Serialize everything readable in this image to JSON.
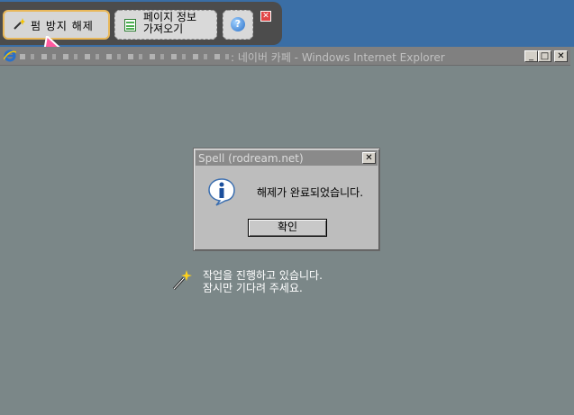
{
  "toolbar": {
    "unlock_label": "펌 방지 해제",
    "page_info_line1": "페이지 정보",
    "page_info_line2": "가져오기",
    "help_glyph": "?",
    "close_glyph": "✕"
  },
  "ie_window": {
    "title": ": 네이버 카페 - Windows Internet Explorer",
    "min_glyph": "_",
    "max_glyph": "□",
    "close_glyph": "✕"
  },
  "dialog": {
    "title": "Spell (rodream.net)",
    "message": "해제가 완료되었습니다.",
    "ok_label": "확인",
    "close_glyph": "✕",
    "icon": "info-icon"
  },
  "progress": {
    "line1": "작업을 진행하고 있습니다.",
    "line2": "잠시만 기다려 주세요."
  },
  "colors": {
    "desktop": "#3a6ea5",
    "toolbar_bg": "#4c4c4c",
    "highlight_border": "#e9b85a",
    "arrow": "#ff5aa0",
    "ie_content_bg": "#7b8788"
  }
}
